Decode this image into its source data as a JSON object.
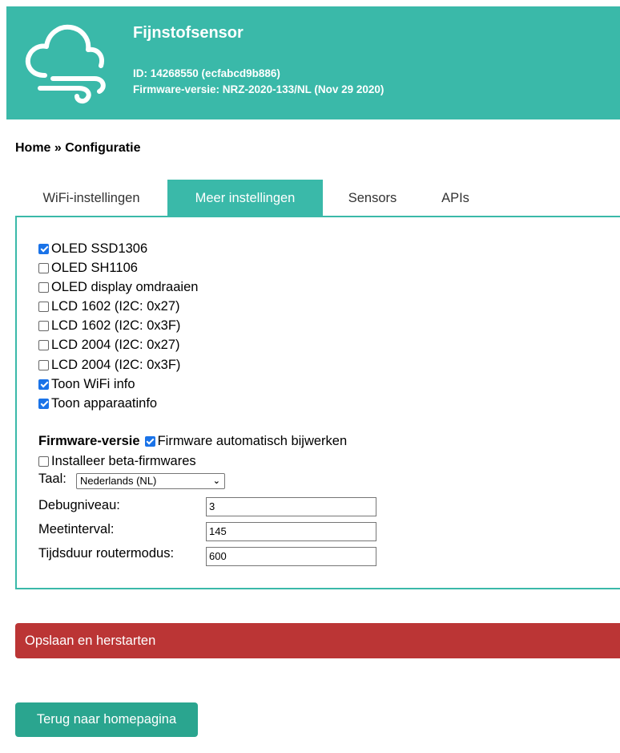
{
  "header": {
    "title": "Fijnstofsensor",
    "id_line": "ID: 14268550 (ecfabcd9b886)",
    "firmware_line": "Firmware-versie: NRZ-2020-133/NL (Nov 29 2020)",
    "logo_icon": "cloud-wind-icon",
    "color": "#3ab9a9"
  },
  "breadcrumb": "Home » Configuratie",
  "tabs": [
    {
      "label": "WiFi-instellingen",
      "active": false
    },
    {
      "label": "Meer instellingen",
      "active": true
    },
    {
      "label": "Sensors",
      "active": false
    },
    {
      "label": "APIs",
      "active": false
    }
  ],
  "options": [
    {
      "label": "OLED SSD1306",
      "checked": true
    },
    {
      "label": "OLED SH1106",
      "checked": false
    },
    {
      "label": "OLED display omdraaien",
      "checked": false
    },
    {
      "label": "LCD 1602 (I2C: 0x27)",
      "checked": false
    },
    {
      "label": "LCD 1602 (I2C: 0x3F)",
      "checked": false
    },
    {
      "label": "LCD 2004 (I2C: 0x27)",
      "checked": false
    },
    {
      "label": "LCD 2004 (I2C: 0x3F)",
      "checked": false
    },
    {
      "label": "Toon WiFi info",
      "checked": true
    },
    {
      "label": "Toon apparaatinfo",
      "checked": true
    }
  ],
  "firmware": {
    "label": "Firmware-versie",
    "auto_update_label": "Firmware automatisch bijwerken",
    "auto_update_checked": true,
    "beta_label": "Installeer beta-firmwares",
    "beta_checked": false
  },
  "language": {
    "label": "Taal:",
    "selected": "Nederlands (NL)"
  },
  "fields": {
    "debug": {
      "label": "Debugniveau:",
      "value": "3"
    },
    "interval": {
      "label": "Meetinterval:",
      "value": "145"
    },
    "router": {
      "label": "Tijdsduur routermodus:",
      "value": "600"
    }
  },
  "buttons": {
    "save": "Opslaan en herstarten",
    "home": "Terug naar homepagina"
  },
  "colors": {
    "accent": "#3ab9a9",
    "danger": "#bb3535",
    "button": "#2aa58f",
    "checkbox": "#1a73e8"
  }
}
